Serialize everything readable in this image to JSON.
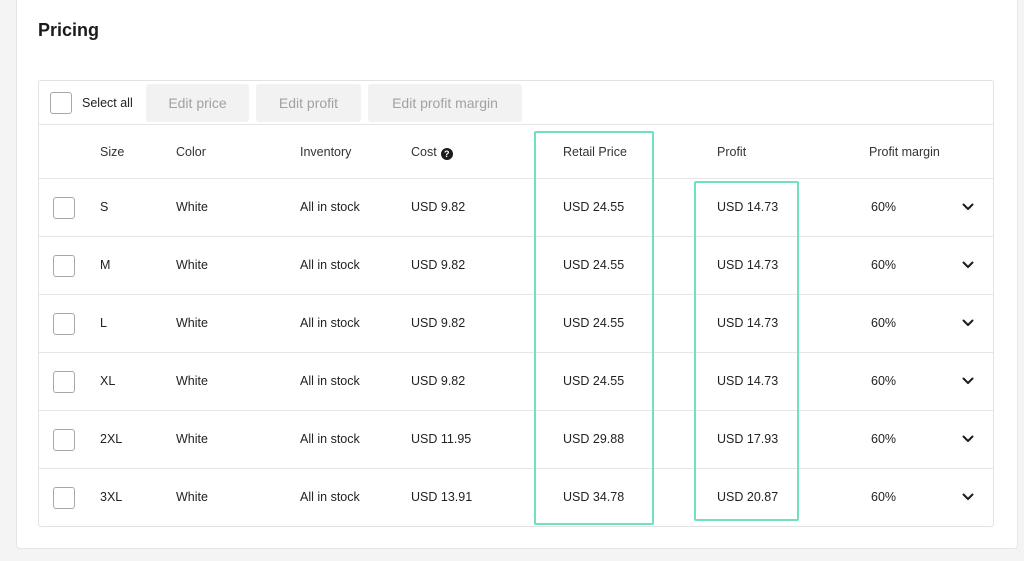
{
  "section": {
    "title": "Pricing"
  },
  "toolbar": {
    "select_all_label": "Select all",
    "edit_price_label": "Edit price",
    "edit_profit_label": "Edit profit",
    "edit_margin_label": "Edit profit margin"
  },
  "table": {
    "headers": {
      "size": "Size",
      "color": "Color",
      "inventory": "Inventory",
      "cost": "Cost",
      "retail_price": "Retail Price",
      "profit": "Profit",
      "profit_margin": "Profit margin"
    },
    "rows": [
      {
        "size": "S",
        "color": "White",
        "inventory": "All in stock",
        "cost": "USD 9.82",
        "retail": "USD 24.55",
        "profit": "USD 14.73",
        "margin": "60%"
      },
      {
        "size": "M",
        "color": "White",
        "inventory": "All in stock",
        "cost": "USD 9.82",
        "retail": "USD 24.55",
        "profit": "USD 14.73",
        "margin": "60%"
      },
      {
        "size": "L",
        "color": "White",
        "inventory": "All in stock",
        "cost": "USD 9.82",
        "retail": "USD 24.55",
        "profit": "USD 14.73",
        "margin": "60%"
      },
      {
        "size": "XL",
        "color": "White",
        "inventory": "All in stock",
        "cost": "USD 9.82",
        "retail": "USD 24.55",
        "profit": "USD 14.73",
        "margin": "60%"
      },
      {
        "size": "2XL",
        "color": "White",
        "inventory": "All in stock",
        "cost": "USD 11.95",
        "retail": "USD 29.88",
        "profit": "USD 17.93",
        "margin": "60%"
      },
      {
        "size": "3XL",
        "color": "White",
        "inventory": "All in stock",
        "cost": "USD 13.91",
        "retail": "USD 34.78",
        "profit": "USD 20.87",
        "margin": "60%"
      }
    ]
  },
  "icons": {
    "help": "question-circle-icon",
    "row_expand": "chevron-down-icon"
  },
  "colors": {
    "highlight": "#6fe0c0",
    "disabled_text": "#a2a2a2",
    "button_bg": "#f2f2f2"
  }
}
